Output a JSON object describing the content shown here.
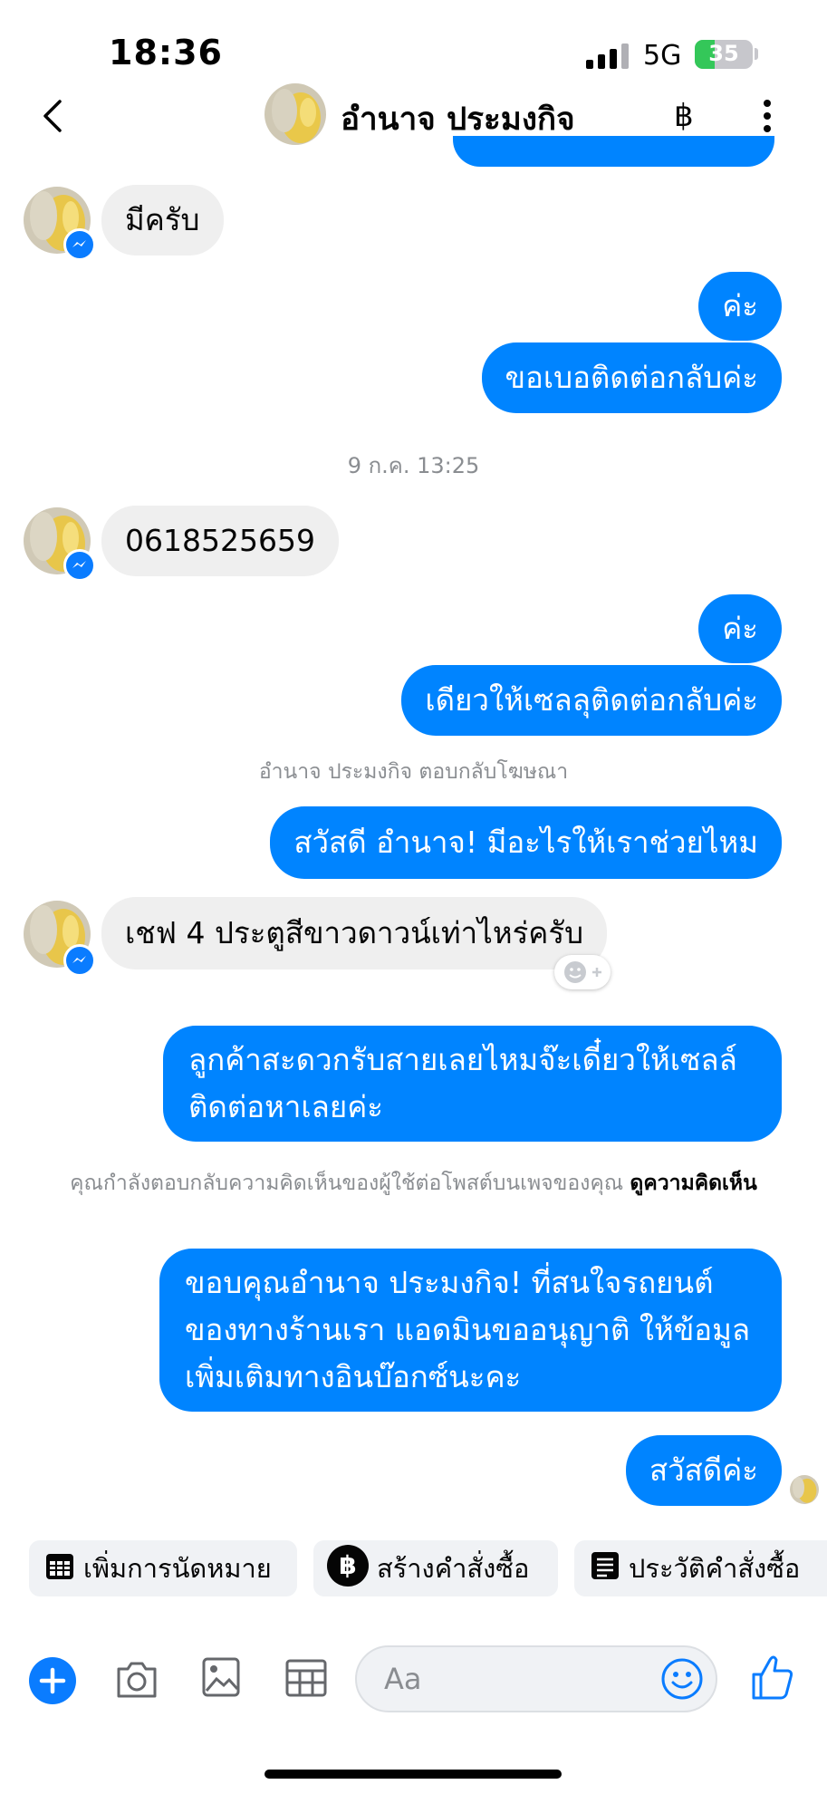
{
  "status_bar": {
    "time": "18:36",
    "network": "5G",
    "battery": "35",
    "battery_level": 0.35
  },
  "header": {
    "contact_name": "อำนาจ ประมงกิจ",
    "currency_icon": "฿"
  },
  "messages": {
    "m1": "มีครับ",
    "m2": "ค่ะ",
    "m3": "ขอเบอติดต่อกลับค่ะ",
    "timestamp": "9 ก.ค. 13:25",
    "m4": "0618525659",
    "m5": "ค่ะ",
    "m6": "เดียวให้เซลลุติดต่อกลับค่ะ",
    "sys_ad_reply": "อำนาจ ประมงกิจ ตอบกลับโฆษณา",
    "m7": "สวัสดี อำนาจ! มีอะไรให้เราช่วยไหม",
    "m8": "เชฟ 4 ประตูสีขาวดาวน์เท่าไหร่ครับ",
    "m9": "ลูกค้าสะดวกรับสายเลยไหมจ๊ะเดี๋ยวให้เซลล์ติดต่อหาเลยค่ะ",
    "sys_comment_text": "คุณกำลังตอบกลับความคิดเห็นของผู้ใช้ต่อโพสต์บนเพจของคุณ",
    "sys_comment_link": "ดูความคิดเห็น",
    "m10": "ขอบคุณอำนาจ ประมงกิจ! ที่สนใจรถยนต์ของทางร้านเรา แอดมินขออนุญาติ ให้ข้อมูลเพิ่มเติมทางอินบ๊อกซ์นะคะ",
    "m11": "สวัสดีค่ะ"
  },
  "quick_actions": {
    "appointment": "เพิ่มการนัดหมาย",
    "create_order": "สร้างคำสั่งซื้อ",
    "order_history": "ประวัติคำสั่งซื้อ"
  },
  "composer": {
    "placeholder": "Aa"
  },
  "colors": {
    "accent": "#0084ff",
    "incoming_bubble": "#efefef",
    "battery_green": "#34c759"
  }
}
